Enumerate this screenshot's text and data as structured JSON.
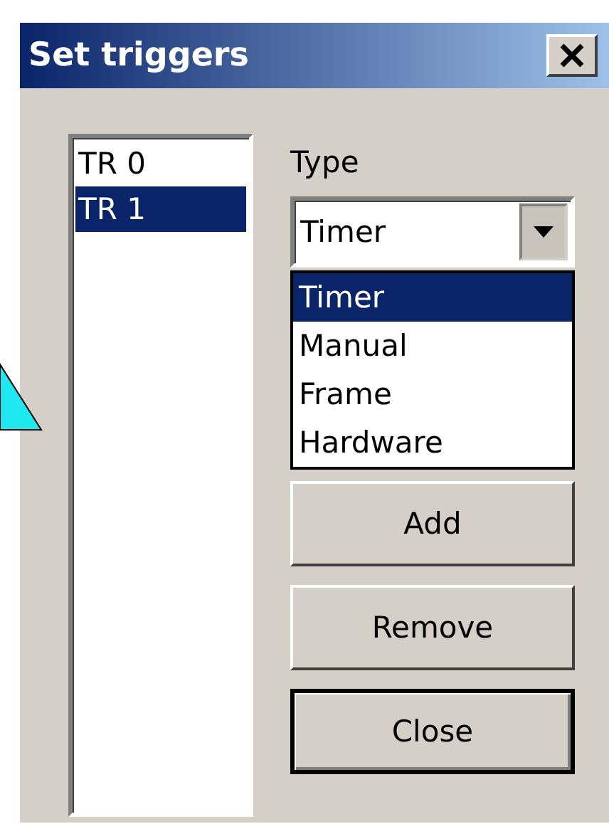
{
  "window": {
    "title": "Set triggers"
  },
  "triggers": [
    {
      "label": "TR 0",
      "selected": false
    },
    {
      "label": "TR 1",
      "selected": true
    }
  ],
  "type": {
    "label": "Type",
    "value": "Timer",
    "expanded": true,
    "options": [
      {
        "label": "Timer",
        "selected": true
      },
      {
        "label": "Manual",
        "selected": false
      },
      {
        "label": "Frame",
        "selected": false
      },
      {
        "label": "Hardware",
        "selected": false
      }
    ]
  },
  "buttons": [
    {
      "label": "Add",
      "default": false
    },
    {
      "label": "Remove",
      "default": false
    },
    {
      "label": "Close",
      "default": true
    }
  ]
}
